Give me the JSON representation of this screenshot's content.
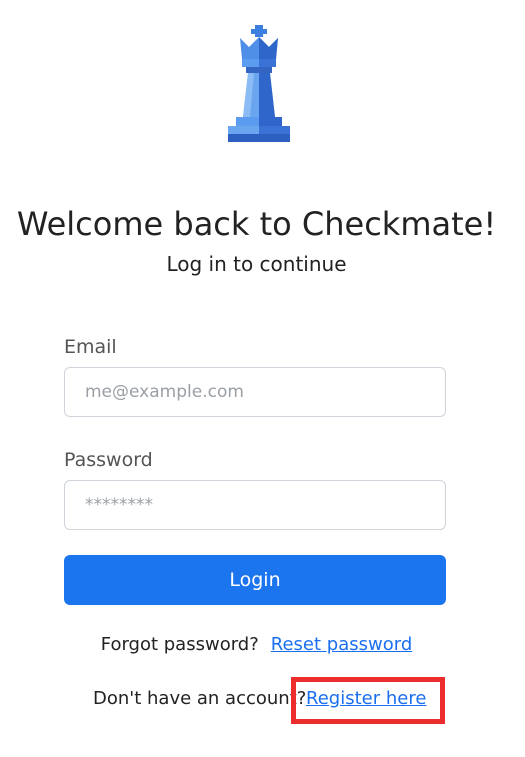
{
  "header": {
    "title": "Welcome back to Checkmate!",
    "subtitle": "Log in to continue"
  },
  "logo": {
    "icon": "chess-queen-icon"
  },
  "form": {
    "email": {
      "label": "Email",
      "placeholder": "me@example.com",
      "value": ""
    },
    "password": {
      "label": "Password",
      "placeholder": "********",
      "value": ""
    },
    "login_label": "Login"
  },
  "footer": {
    "forgot_text": "Forgot password?",
    "reset_link": "Reset password",
    "no_account_text": "Don't have an account?",
    "register_link": "Register here"
  },
  "colors": {
    "primary": "#1b75ee",
    "link": "#1a6ff0",
    "highlight": "#ec2d2d",
    "queen_light": "#6aa6f0",
    "queen_dark": "#2f66c9"
  }
}
